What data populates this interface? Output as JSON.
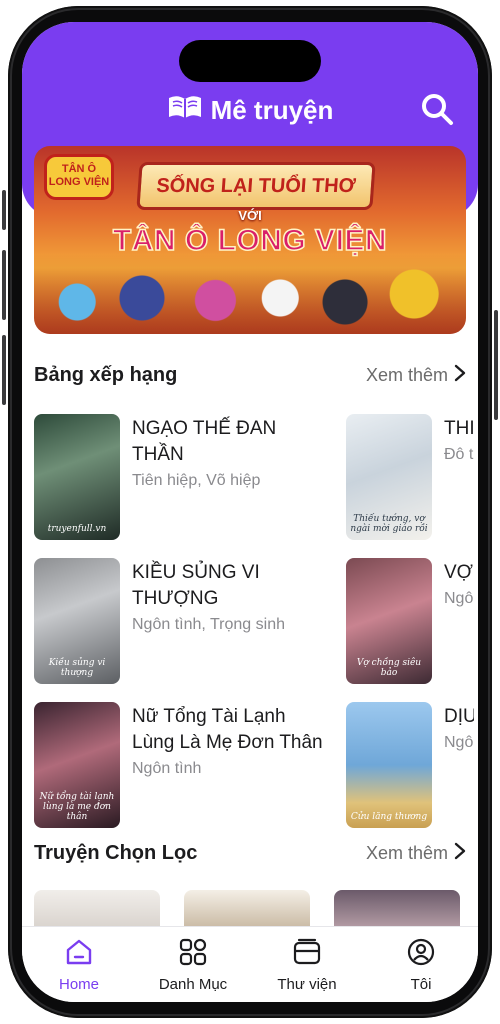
{
  "app": {
    "title": "Mê truyện",
    "accent": "#7a3df0"
  },
  "banner": {
    "logo_text": "TÂN Ô LONG VIỆN",
    "ribbon": "SỐNG LẠI TUỔI THƠ",
    "with": "VỚI",
    "headline": "TÂN Ô LONG VIỆN"
  },
  "ranking": {
    "title": "Bảng xếp hạng",
    "see_more": "Xem thêm",
    "books": [
      {
        "title": "NGẠO THẾ ĐAN THẦN",
        "genre": "Tiên hiệp, Võ hiệp",
        "cover_caption": "truyenfull.vn"
      },
      {
        "title": "KIỀU SỦNG VI THƯỢNG",
        "genre": "Ngôn tình, Trọng sinh",
        "cover_caption": "Kiều sủng vi thượng"
      },
      {
        "title": "Nữ Tổng Tài Lạnh Lùng Là Mẹ Đơn Thân",
        "genre": "Ngôn tình",
        "cover_caption": "Nữ tổng tài lạnh lùng là mẹ đơn thân"
      }
    ],
    "books_right": [
      {
        "title": "THI NGÃ",
        "genre": "Đô t",
        "cover_caption": "Thiếu tướng, vợ ngài mời giáo rồi"
      },
      {
        "title": "VỢ C HƠI",
        "genre": "Ngô",
        "cover_caption": "Vợ chồng siêu bảo"
      },
      {
        "title": "DỊU XƯƠ",
        "genre": "Ngô",
        "cover_caption": "Cửu lăng thương"
      }
    ]
  },
  "picks": {
    "title": "Truyện Chọn Lọc",
    "see_more": "Xem thêm"
  },
  "tabs": [
    {
      "label": "Home",
      "icon": "home-icon",
      "active": true
    },
    {
      "label": "Danh Mục",
      "icon": "grid-icon",
      "active": false
    },
    {
      "label": "Thư viện",
      "icon": "library-icon",
      "active": false
    },
    {
      "label": "Tôi",
      "icon": "user-icon",
      "active": false
    }
  ]
}
